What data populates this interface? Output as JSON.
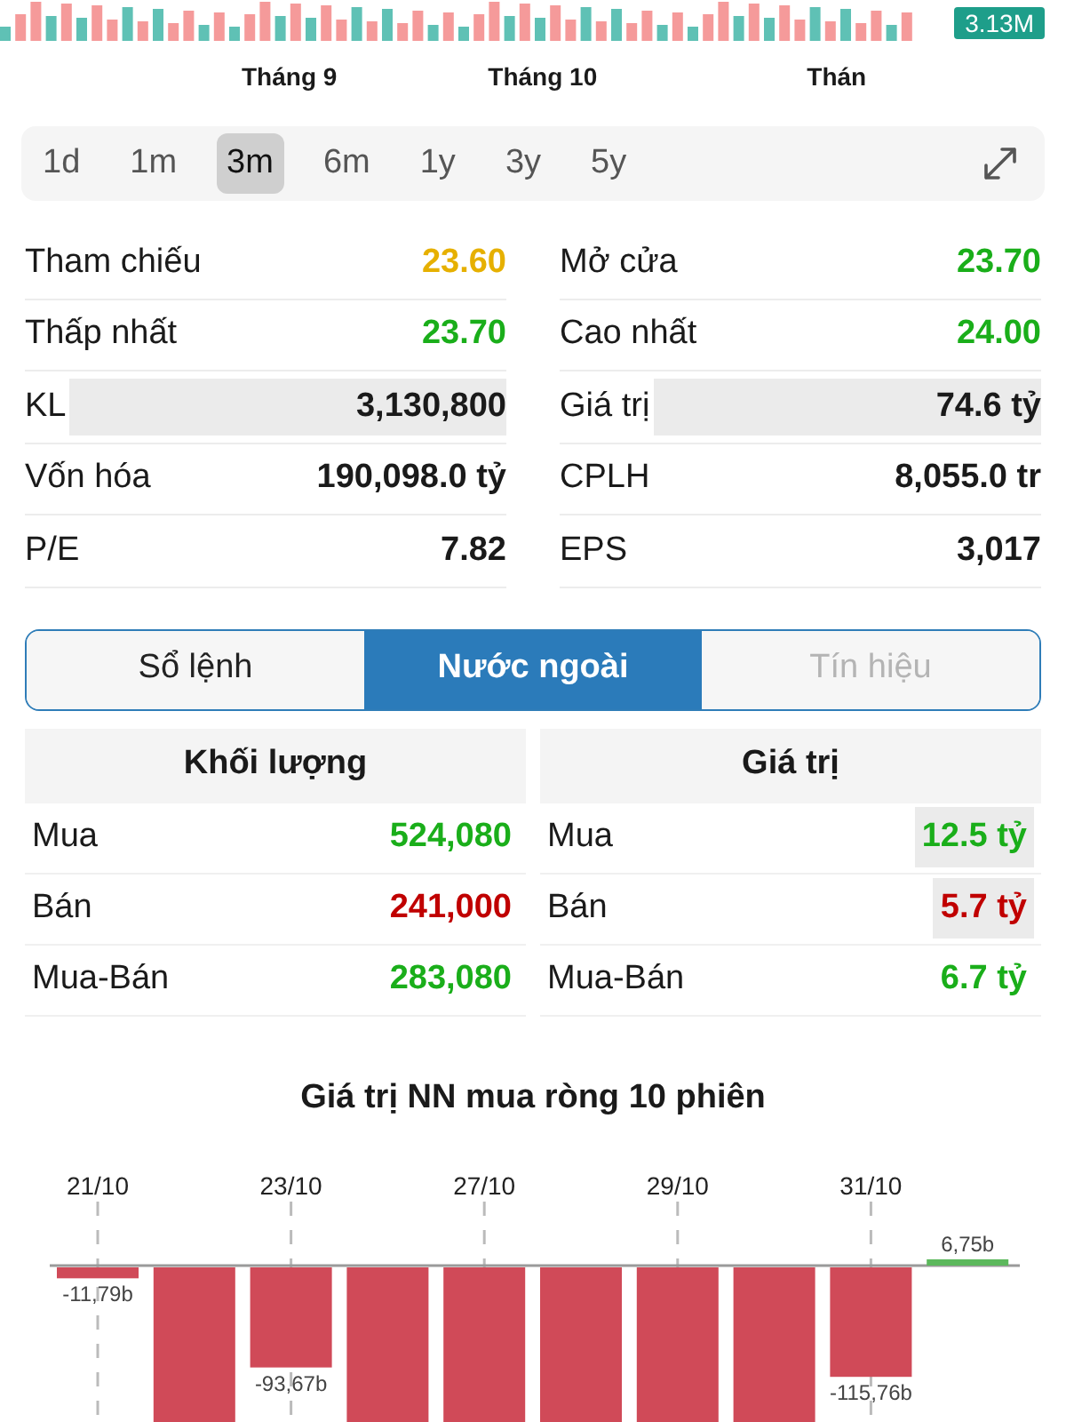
{
  "volume_strip": {
    "badge": "3.13M"
  },
  "months": [
    "Tháng 9",
    "Tháng 10",
    "Thán"
  ],
  "periods": [
    {
      "label": "1d",
      "selected": false
    },
    {
      "label": "1m",
      "selected": false
    },
    {
      "label": "3m",
      "selected": true
    },
    {
      "label": "6m",
      "selected": false
    },
    {
      "label": "1y",
      "selected": false
    },
    {
      "label": "3y",
      "selected": false
    },
    {
      "label": "5y",
      "selected": false
    }
  ],
  "stats": [
    {
      "label": "Tham chiếu",
      "value": "23.60",
      "color": "#e6b000",
      "highlighted": false
    },
    {
      "label": "Mở cửa",
      "value": "23.70",
      "color": "#1aae1a",
      "highlighted": false
    },
    {
      "label": "Thấp nhất",
      "value": "23.70",
      "color": "#1aae1a",
      "highlighted": false
    },
    {
      "label": "Cao nhất",
      "value": "24.00",
      "color": "#1aae1a",
      "highlighted": false
    },
    {
      "label": "KL",
      "value": "3,130,800",
      "color": "#1a1a1a",
      "highlighted": true
    },
    {
      "label": "Giá trị",
      "value": "74.6 tỷ",
      "color": "#1a1a1a",
      "highlighted": true
    },
    {
      "label": "Vốn hóa",
      "value": "190,098.0 tỷ",
      "color": "#1a1a1a",
      "highlighted": false
    },
    {
      "label": "CPLH",
      "value": "8,055.0 tr",
      "color": "#1a1a1a",
      "highlighted": false
    },
    {
      "label": "P/E",
      "value": "7.82",
      "color": "#1a1a1a",
      "highlighted": false
    },
    {
      "label": "EPS",
      "value": "3,017",
      "color": "#1a1a1a",
      "highlighted": false
    }
  ],
  "tabs": [
    {
      "label": "Sổ lệnh",
      "selected": false,
      "disabled": false
    },
    {
      "label": "Nước ngoài",
      "selected": true,
      "disabled": false
    },
    {
      "label": "Tín hiệu",
      "selected": false,
      "disabled": true
    }
  ],
  "foreign": [
    {
      "title": "Khối lượng",
      "rows": [
        {
          "label": "Mua",
          "value": "524,080",
          "color": "#1aae1a",
          "highlighted": false
        },
        {
          "label": "Bán",
          "value": "241,000",
          "color": "#c00000",
          "highlighted": false
        },
        {
          "label": "Mua-Bán",
          "value": "283,080",
          "color": "#1aae1a",
          "highlighted": false
        }
      ]
    },
    {
      "title": "Giá trị",
      "rows": [
        {
          "label": "Mua",
          "value": "12.5 tỷ",
          "color": "#1aae1a",
          "highlighted": true
        },
        {
          "label": "Bán",
          "value": "5.7 tỷ",
          "color": "#c00000",
          "highlighted": true
        },
        {
          "label": "Mua-Bán",
          "value": "6.7 tỷ",
          "color": "#1aae1a",
          "highlighted": false
        }
      ]
    }
  ],
  "net_chart": {
    "title": "Giá trị NN mua ròng 10 phiên",
    "bars": [
      {
        "date": "21/10",
        "kind": "negative",
        "color": "#d04a58",
        "level": 0.07,
        "label": "-11,79b"
      },
      {
        "kind": "negative",
        "color": "#d04a58",
        "level": 1
      },
      {
        "date": "23/10",
        "kind": "negative",
        "color": "#d04a58",
        "level": 0.64,
        "label": "-93,67b"
      },
      {
        "kind": "negative",
        "color": "#d04a58",
        "level": 1
      },
      {
        "date": "27/10",
        "kind": "negative",
        "color": "#d04a58",
        "level": 1
      },
      {
        "kind": "negative",
        "color": "#d04a58",
        "level": 1
      },
      {
        "date": "29/10",
        "kind": "negative",
        "color": "#d04a58",
        "level": 1
      },
      {
        "kind": "negative",
        "color": "#d04a58",
        "level": 1
      },
      {
        "date": "31/10",
        "kind": "negative",
        "color": "#d04a58",
        "level": 0.7,
        "label": "-115,76b"
      },
      {
        "kind": "positive",
        "color": "#5cb85c",
        "level": 0.04,
        "label": "6,75b"
      }
    ]
  }
}
